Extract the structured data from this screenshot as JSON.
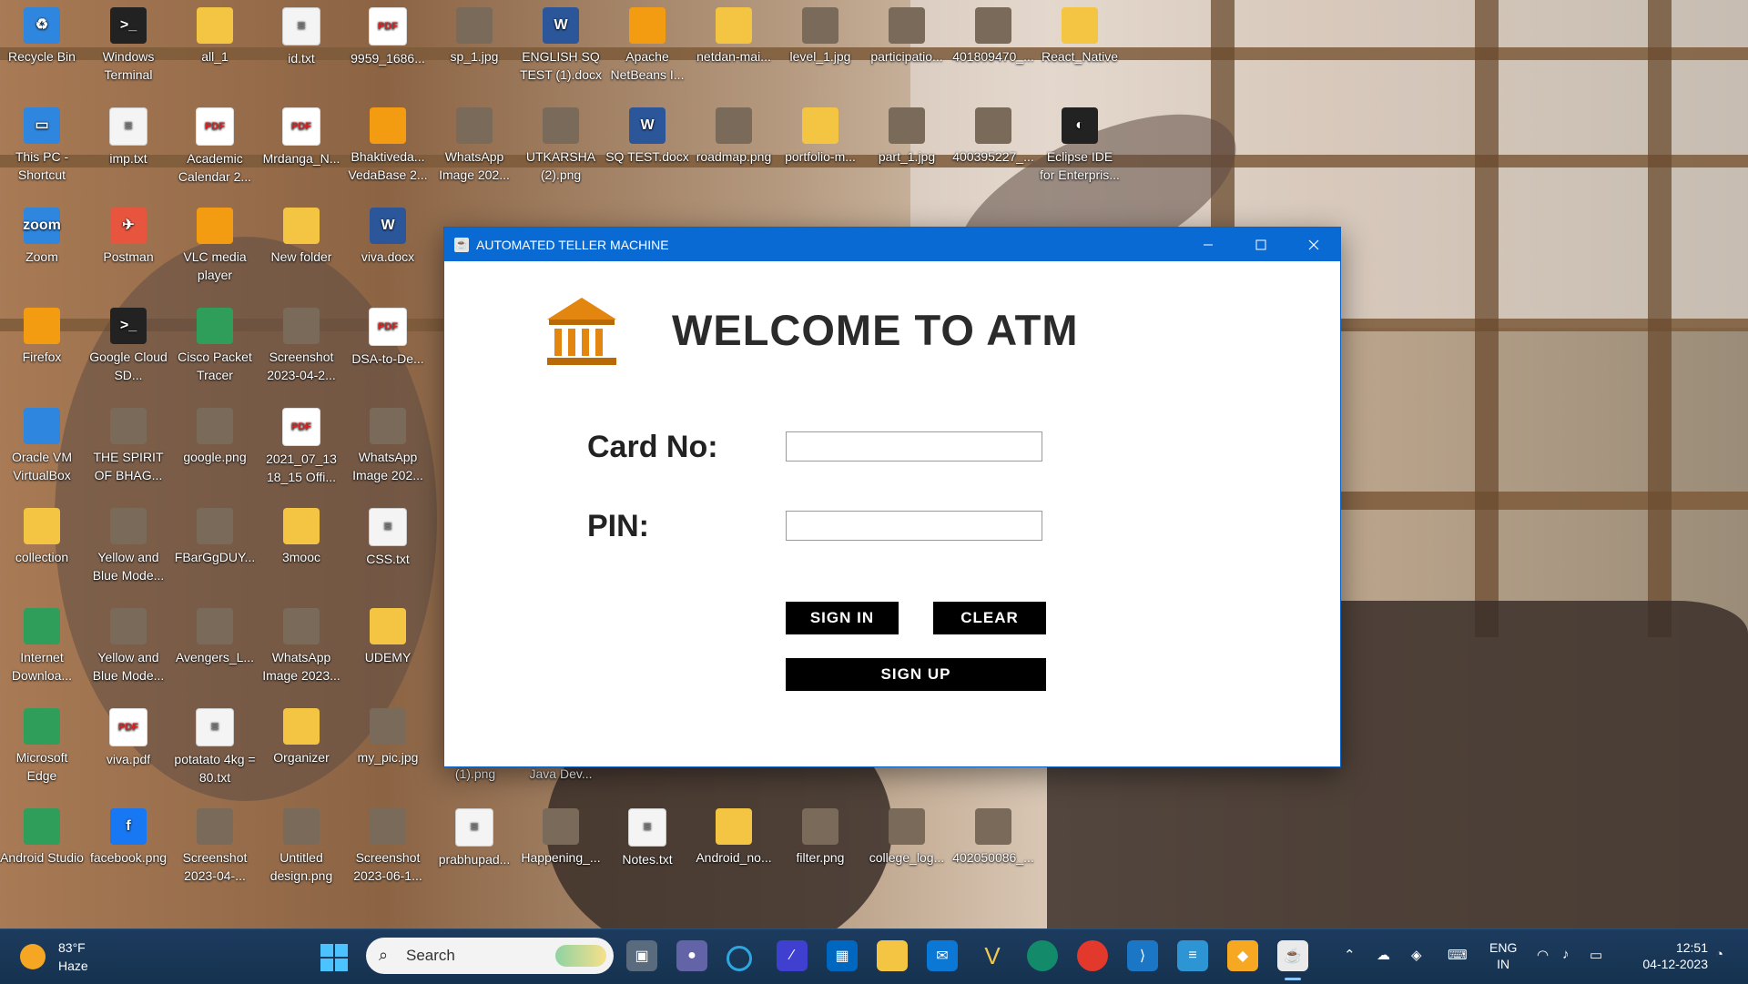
{
  "window": {
    "title": "AUTOMATED TELLER MACHINE",
    "heading": "WELCOME TO ATM",
    "card_label": "Card No:",
    "pin_label": "PIN:",
    "card_value": "",
    "pin_value": "",
    "sign_in": "SIGN IN",
    "clear": "CLEAR",
    "sign_up": "SIGN UP",
    "accent": "#0a6ad4",
    "logo_color": "#e2860f"
  },
  "desktop_icons": [
    {
      "label": "Recycle Bin",
      "icon": "recycle-bin-icon"
    },
    {
      "label": "Windows Terminal",
      "icon": "terminal-icon"
    },
    {
      "label": "all_1",
      "icon": "folder-icon"
    },
    {
      "label": "id.txt",
      "icon": "text-file-icon"
    },
    {
      "label": "9959_1686...",
      "icon": "pdf-icon"
    },
    {
      "label": "sp_1.jpg",
      "icon": "image-icon"
    },
    {
      "label": "ENGLISH SQ TEST (1).docx",
      "icon": "word-icon"
    },
    {
      "label": "Apache NetBeans I...",
      "icon": "netbeans-icon"
    },
    {
      "label": "netdan-mai...",
      "icon": "folder-icon"
    },
    {
      "label": "level_1.jpg",
      "icon": "image-icon"
    },
    {
      "label": "participatio...",
      "icon": "image-icon"
    },
    {
      "label": "401809470_...",
      "icon": "image-icon"
    },
    {
      "label": "React_Native",
      "icon": "folder-icon"
    },
    {
      "label": "This PC - Shortcut",
      "icon": "pc-icon"
    },
    {
      "label": "imp.txt",
      "icon": "text-file-icon"
    },
    {
      "label": "Academic Calendar 2...",
      "icon": "pdf-icon"
    },
    {
      "label": "Mrdanga_N...",
      "icon": "pdf-icon"
    },
    {
      "label": "Bhaktiveda... VedaBase 2...",
      "icon": "app-icon"
    },
    {
      "label": "WhatsApp Image 202...",
      "icon": "image-icon"
    },
    {
      "label": "UTKARSHA (2).png",
      "icon": "image-icon"
    },
    {
      "label": "SQ TEST.docx",
      "icon": "word-icon"
    },
    {
      "label": "roadmap.png",
      "icon": "image-icon"
    },
    {
      "label": "portfolio-m...",
      "icon": "folder-icon"
    },
    {
      "label": "part_1.jpg",
      "icon": "image-icon"
    },
    {
      "label": "400395227_...",
      "icon": "image-icon"
    },
    {
      "label": "Eclipse IDE for Enterpris...",
      "icon": "eclipse-icon"
    },
    {
      "label": "Zoom",
      "icon": "zoom-icon"
    },
    {
      "label": "Postman",
      "icon": "postman-icon"
    },
    {
      "label": "VLC media player",
      "icon": "vlc-icon"
    },
    {
      "label": "New folder",
      "icon": "folder-icon"
    },
    {
      "label": "viva.docx",
      "icon": "word-icon"
    },
    {
      "label": "Firefox",
      "icon": "firefox-icon"
    },
    {
      "label": "Google Cloud SD...",
      "icon": "terminal-icon"
    },
    {
      "label": "Cisco Packet Tracer",
      "icon": "cisco-icon"
    },
    {
      "label": "Screenshot 2023-04-2...",
      "icon": "image-icon"
    },
    {
      "label": "DSA-to-De...",
      "icon": "pdf-icon"
    },
    {
      "label": "Oracle VM VirtualBox",
      "icon": "virtualbox-icon"
    },
    {
      "label": "THE SPIRIT OF BHAG...",
      "icon": "image-icon"
    },
    {
      "label": "google.png",
      "icon": "image-icon"
    },
    {
      "label": "2021_07_13 18_15 Offi...",
      "icon": "pdf-icon"
    },
    {
      "label": "WhatsApp Image 202...",
      "icon": "image-icon"
    },
    {
      "label": "collection",
      "icon": "folder-icon"
    },
    {
      "label": "Yellow and Blue Mode...",
      "icon": "image-icon"
    },
    {
      "label": "FBarGgDUY...",
      "icon": "image-icon"
    },
    {
      "label": "3mooc",
      "icon": "folder-icon"
    },
    {
      "label": "CSS.txt",
      "icon": "text-file-icon"
    },
    {
      "label": "Internet Downloa...",
      "icon": "idm-icon"
    },
    {
      "label": "Yellow and Blue Mode...",
      "icon": "image-icon"
    },
    {
      "label": "Avengers_L...",
      "icon": "image-icon"
    },
    {
      "label": "WhatsApp Image 2023...",
      "icon": "image-icon"
    },
    {
      "label": "UDEMY",
      "icon": "folder-icon"
    },
    {
      "label": "Microsoft Edge",
      "icon": "edge-icon"
    },
    {
      "label": "viva.pdf",
      "icon": "pdf-icon"
    },
    {
      "label": "potatato 4kg = 80.txt",
      "icon": "text-file-icon"
    },
    {
      "label": "Organizer",
      "icon": "folder-icon"
    },
    {
      "label": "my_pic.jpg",
      "icon": "image-icon"
    },
    {
      "label": "Android Studio",
      "icon": "android-studio-icon"
    },
    {
      "label": "facebook.png",
      "icon": "facebook-icon"
    },
    {
      "label": "Screenshot 2023-04-...",
      "icon": "image-icon"
    },
    {
      "label": "Untitled design.png",
      "icon": "image-icon"
    },
    {
      "label": "Screenshot 2023-06-1...",
      "icon": "image-icon"
    },
    {
      "label": "prabhupad...",
      "icon": "text-file-icon"
    },
    {
      "label": "Happening_...",
      "icon": "image-icon"
    },
    {
      "label": "Notes.txt",
      "icon": "text-file-icon"
    },
    {
      "label": "Android_no...",
      "icon": "folder-icon"
    },
    {
      "label": "filter.png",
      "icon": "image-icon"
    },
    {
      "label": "college_log...",
      "icon": "image-icon"
    },
    {
      "label": "402050086_...",
      "icon": "image-icon"
    }
  ],
  "partial_labels": {
    "png": "(1).png",
    "java": "Java Dev..."
  },
  "taskbar": {
    "temperature": "83°F",
    "condition": "Haze",
    "search_placeholder": "Search",
    "language": "ENG",
    "region": "IN",
    "time": "12:51",
    "date": "04-12-2023"
  }
}
